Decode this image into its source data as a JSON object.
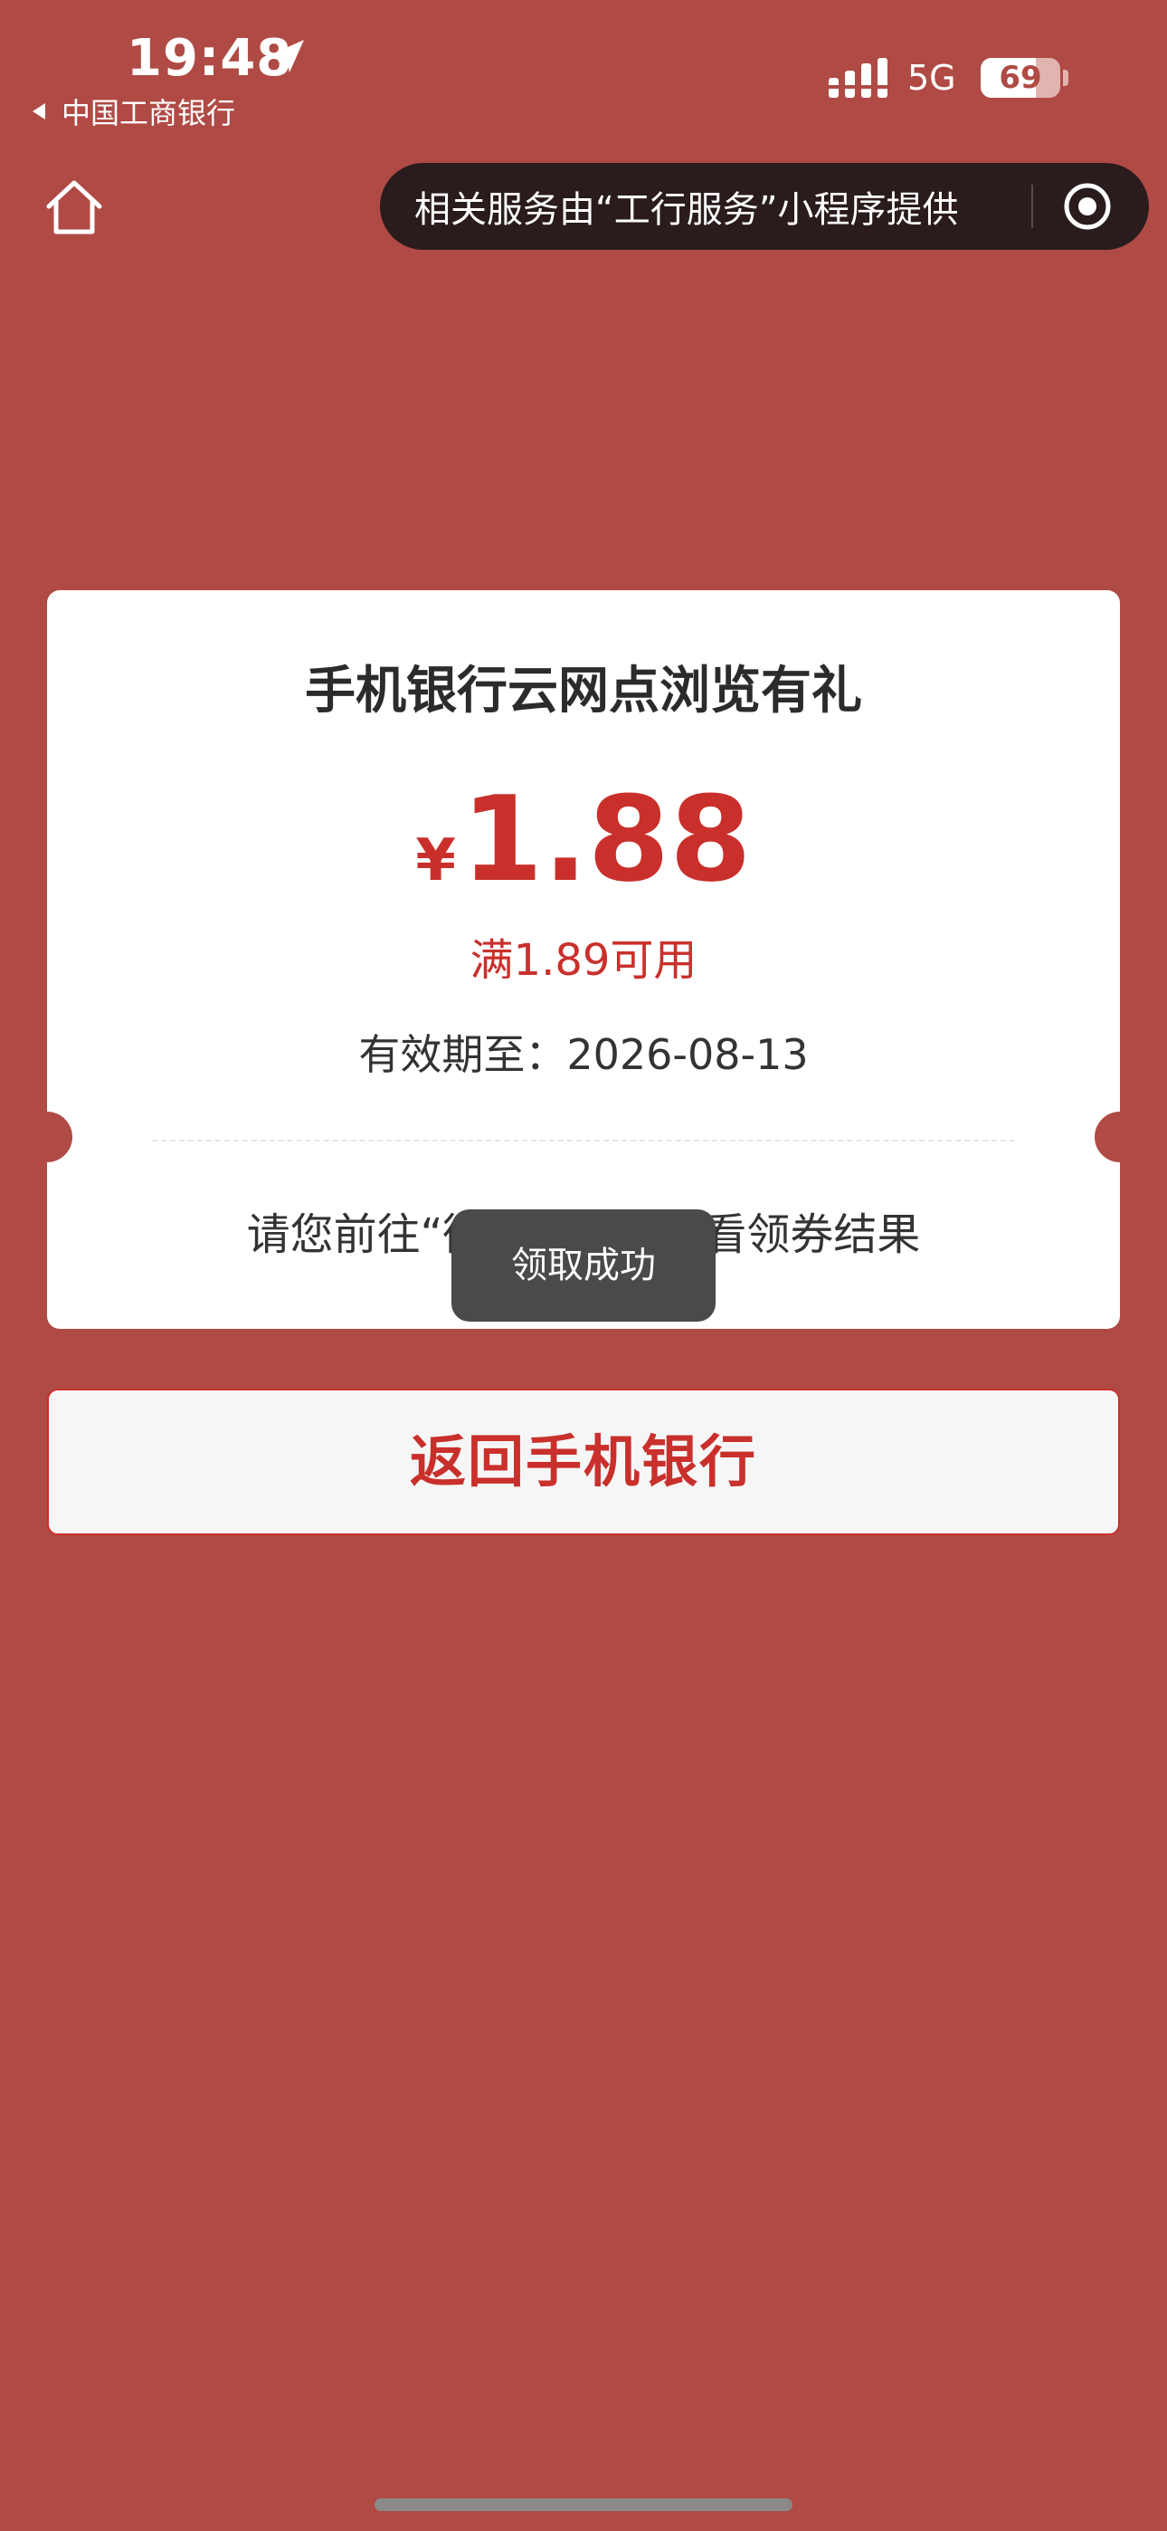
{
  "status_bar": {
    "time": "19:48",
    "back_app": "中国工商银行",
    "network": "5G",
    "battery": "69",
    "battery_level": 0.69
  },
  "nav": {
    "capsule_text": "相关服务由“工行服务”小程序提供"
  },
  "coupon": {
    "title": "手机银行云网点浏览有礼",
    "currency": "¥",
    "amount": "1.88",
    "threshold": "满1.89可用",
    "validity": "有效期至：2026-08-13",
    "hint": "请您前往“微　　　　　看领券结果"
  },
  "toast": {
    "message": "领取成功"
  },
  "actions": {
    "return_label": "返回手机银行"
  },
  "colors": {
    "background": "#b04a44",
    "accent_red": "#c9302c",
    "card": "#ffffff"
  },
  "icons": {
    "home": "home-icon",
    "location": "location-arrow-icon",
    "signal": "cellular-signal-icon",
    "close_target": "target-icon"
  }
}
